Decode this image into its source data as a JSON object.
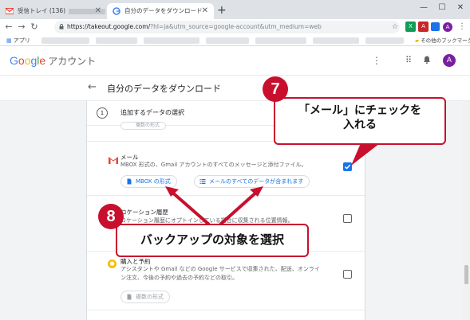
{
  "browser": {
    "tabs": [
      {
        "label": "受信トレイ (136)",
        "active": false
      },
      {
        "label": "自分のデータをダウンロード",
        "active": true
      }
    ],
    "new_tab": "+",
    "url_host": "https://takeout.google.com/",
    "url_query": "?hl=ja&utm_source=google-account&utm_medium=web",
    "bookmarks_apps": "アプリ",
    "bookmarks_other": "その他のブックマーク",
    "profile_initial": "A"
  },
  "header": {
    "logo_letters": [
      "G",
      "o",
      "o",
      "g",
      "l",
      "e"
    ],
    "logo_colors": [
      "#4285f4",
      "#ea4335",
      "#fbbc05",
      "#4285f4",
      "#34a853",
      "#ea4335"
    ],
    "account_label": "アカウント",
    "avatar_initial": "A",
    "avatar_color": "#7b1fa2"
  },
  "page": {
    "back_icon": "arrow-left-icon",
    "title": "自分のデータをダウンロード"
  },
  "step": {
    "number": "1",
    "label": "追加するデータの選択"
  },
  "ghost_chip_top": "複数の形式",
  "services": [
    {
      "name": "メール",
      "description": "MBOX 形式の、Gmail アカウントのすべてのメッセージと添付ファイル。",
      "checked": true,
      "chips": [
        "MBOX の形式",
        "メールのすべてのデータが含まれます"
      ]
    },
    {
      "name": "ロケーション履歴",
      "description": "ロケーション履歴にオプトインしている場合に収集される位置情報。",
      "checked": false
    },
    {
      "name": "購入と予約",
      "description_lines": [
        "アシスタントや Gmail などの Google サービスで収集された、配送、オンライ",
        "ン注文、今後の予約や過去の予約などの取引。"
      ],
      "checked": false,
      "chips": [
        "複数の形式"
      ]
    }
  ],
  "annotations": {
    "callout7": {
      "number": "7",
      "lines": [
        "「メール」にチェックを",
        "入れる"
      ]
    },
    "callout8": {
      "number": "8",
      "text": "バックアップの対象を選択"
    },
    "accent_color": "#c8102e"
  },
  "colors": {
    "link_blue": "#1a73e8",
    "gmail_red": "#ea4335"
  }
}
